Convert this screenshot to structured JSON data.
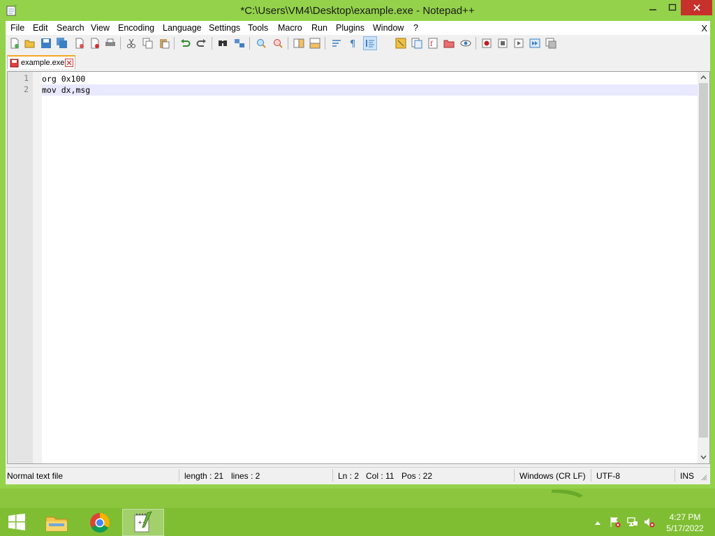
{
  "window": {
    "title": "*C:\\Users\\VM4\\Desktop\\example.exe - Notepad++",
    "minimize_glyph": "—",
    "maximize_glyph": "☐",
    "close_glyph": "✕"
  },
  "menu": {
    "items": [
      "File",
      "Edit",
      "Search",
      "View",
      "Encoding",
      "Language",
      "Settings",
      "Tools",
      "Macro",
      "Run",
      "Plugins",
      "Window",
      "?"
    ],
    "close_label": "X"
  },
  "toolbar": {
    "icons": [
      "new-file-icon",
      "open-file-icon",
      "save-icon",
      "save-all-icon",
      "close-icon",
      "close-all-icon",
      "print-icon",
      "cut-icon",
      "copy-icon",
      "paste-icon",
      "undo-icon",
      "redo-icon",
      "find-icon",
      "replace-icon",
      "zoom-in-icon",
      "zoom-out-icon",
      "sync-vertical-icon",
      "sync-horizontal-icon",
      "word-wrap-icon",
      "show-all-characters-icon",
      "indent-guide-icon",
      "user-defined-language-icon",
      "document-map-icon",
      "function-list-icon",
      "folder-as-workspace-icon",
      "monitoring-icon",
      "record-macro-icon",
      "stop-macro-icon",
      "play-macro-icon",
      "run-macro-multiple-icon",
      "save-macro-icon"
    ],
    "active_icon": "indent-guide-icon"
  },
  "tabs": [
    {
      "label": "example.exe",
      "modified": true
    }
  ],
  "editor": {
    "lines": [
      {
        "number": "1",
        "text": "org 0x100"
      },
      {
        "number": "2",
        "text": "mov dx,msg"
      }
    ],
    "current_line": 2,
    "current_line_color": "#e8e8ff"
  },
  "statusbar": {
    "file_type": "Normal text file",
    "length": "length : 21",
    "lines": "lines : 2",
    "ln": "Ln : 2",
    "col": "Col : 11",
    "pos": "Pos : 22",
    "eol": "Windows (CR LF)",
    "encoding": "UTF-8",
    "mode": "INS"
  },
  "taskbar": {
    "apps": [
      "file-explorer-icon",
      "chrome-icon",
      "notepad-plus-plus-icon"
    ],
    "running_app": "notepad-plus-plus-icon",
    "tray_icons": [
      "show-hidden-icons-chevron",
      "action-center-icon",
      "network-icon",
      "volume-muted-icon"
    ],
    "time": "4:27 PM",
    "date": "5/17/2022"
  },
  "colors": {
    "accent_green": "#8cc63f",
    "close_red": "#c7312b",
    "tab_accent": "#f5a623"
  }
}
